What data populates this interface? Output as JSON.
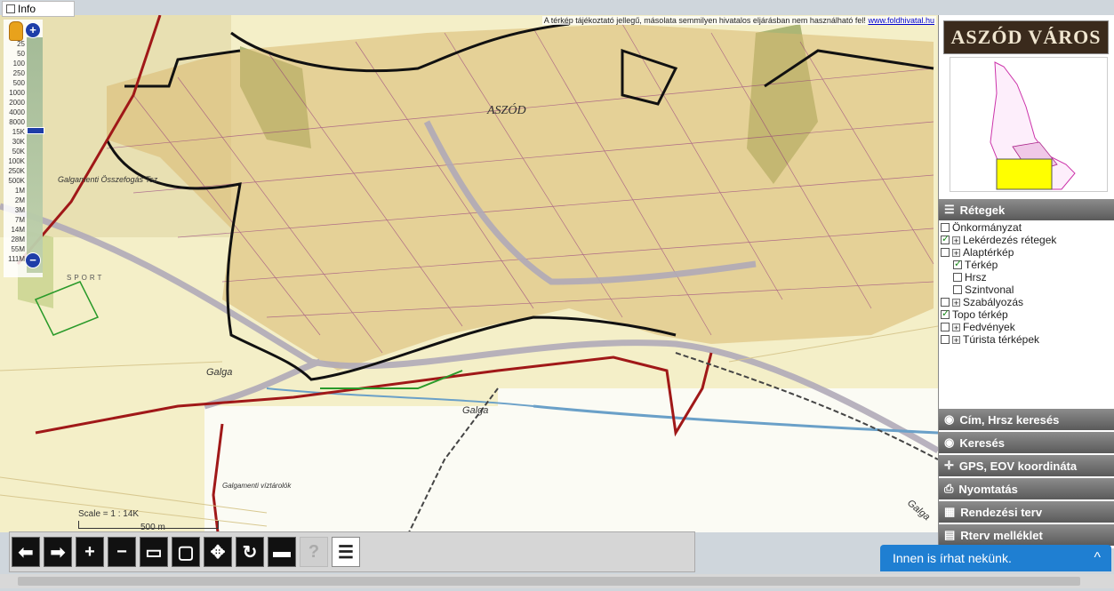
{
  "info": {
    "label": "Info",
    "checked": false
  },
  "disclaimer": {
    "text": "A térkép tájékoztató jellegű, másolata semmilyen hivatalos eljárásban nem használható fel!",
    "link": "www.foldhivatal.hu"
  },
  "zoom": {
    "plus": "+",
    "minus": "−",
    "scales": [
      "25",
      "50",
      "100",
      "250",
      "500",
      "1000",
      "2000",
      "4000",
      "8000",
      "15K",
      "30K",
      "50K",
      "100K",
      "250K",
      "500K",
      "1M",
      "2M",
      "3M",
      "7M",
      "14M",
      "28M",
      "55M",
      "111M"
    ]
  },
  "scalebar": {
    "label": "Scale = 1 : 14K",
    "distance": "500 m"
  },
  "map_labels": {
    "town": "ASZÓD",
    "galga1": "Galga",
    "galga2": "Galga",
    "galga3": "Galga",
    "area1": "Galgamenti Összefogás Tsz",
    "area2": "Galgamenti víztárolók",
    "sport": "SPORT"
  },
  "toolbar": {
    "buttons": [
      {
        "name": "back-button",
        "glyph": "⬅",
        "enabled": true
      },
      {
        "name": "forward-button",
        "glyph": "➡",
        "enabled": true
      },
      {
        "name": "zoom-in-button",
        "glyph": "+",
        "enabled": true
      },
      {
        "name": "zoom-out-button",
        "glyph": "−",
        "enabled": true
      },
      {
        "name": "zoom-box-button",
        "glyph": "▭",
        "enabled": true
      },
      {
        "name": "zoom-extent-button",
        "glyph": "▢",
        "enabled": true
      },
      {
        "name": "pan-button",
        "glyph": "✥",
        "enabled": true
      },
      {
        "name": "refresh-button",
        "glyph": "↻",
        "enabled": true
      },
      {
        "name": "measure-button",
        "glyph": "▬",
        "enabled": true
      },
      {
        "name": "help-button",
        "glyph": "?",
        "enabled": false
      },
      {
        "name": "document-button",
        "glyph": "☰",
        "enabled": true
      }
    ]
  },
  "right_panel": {
    "logo": "ASZÓD VÁROS",
    "layers_header": "Rétegek",
    "layers": [
      {
        "label": "Önkormányzat",
        "checked": false,
        "plus": false,
        "indent": 0
      },
      {
        "label": "Lekérdezés rétegek",
        "checked": true,
        "plus": true,
        "indent": 0
      },
      {
        "label": "Alaptérkép",
        "checked": false,
        "plus": true,
        "indent": 0
      },
      {
        "label": "Térkép",
        "checked": true,
        "plus": false,
        "indent": 1
      },
      {
        "label": "Hrsz",
        "checked": false,
        "plus": false,
        "indent": 1
      },
      {
        "label": "Szintvonal",
        "checked": false,
        "plus": false,
        "indent": 1
      },
      {
        "label": "Szabályozás",
        "checked": false,
        "plus": true,
        "indent": 0
      },
      {
        "label": "Topo térkép",
        "checked": true,
        "plus": false,
        "indent": 0
      },
      {
        "label": "Fedvények",
        "checked": false,
        "plus": true,
        "indent": 0
      },
      {
        "label": "Túrista térképek",
        "checked": false,
        "plus": true,
        "indent": 0
      }
    ],
    "sections": [
      {
        "label": "Cím, Hrsz keresés",
        "icon": "eye-icon"
      },
      {
        "label": "Keresés",
        "icon": "eye-icon"
      },
      {
        "label": "GPS, EOV koordináta",
        "icon": "crosshair-icon"
      },
      {
        "label": "Nyomtatás",
        "icon": "printer-icon"
      },
      {
        "label": "Rendezési terv",
        "icon": "plan-icon"
      },
      {
        "label": "Rterv melléklet",
        "icon": "book-icon"
      }
    ]
  },
  "chat": {
    "label": "Innen is írhat nekünk.",
    "chevron": "^"
  }
}
